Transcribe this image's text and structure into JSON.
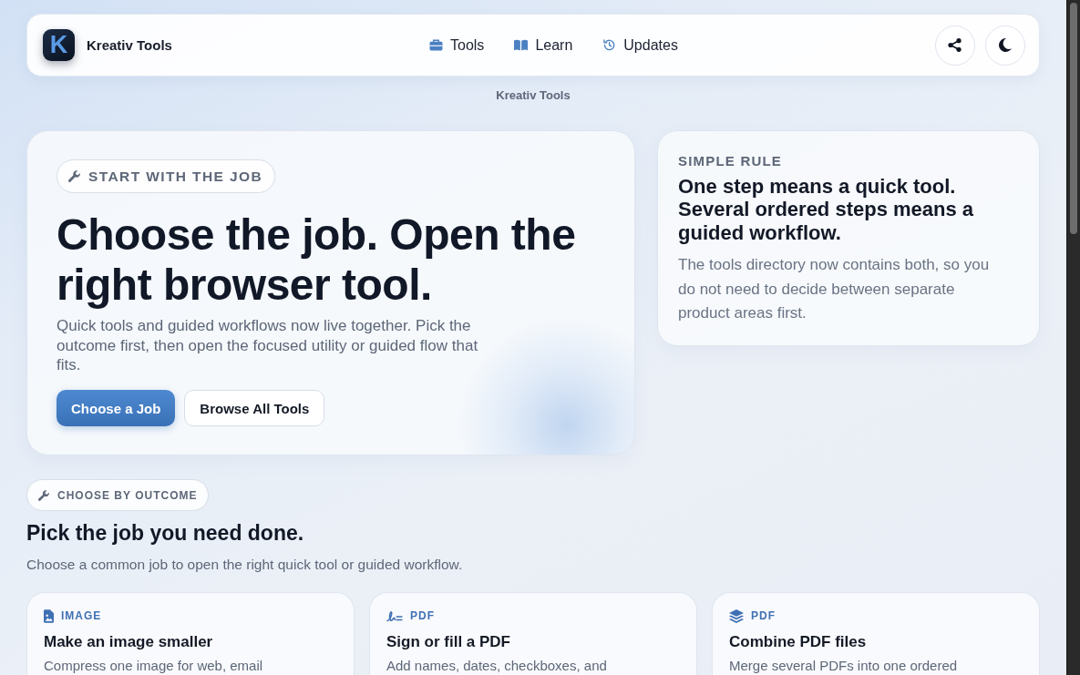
{
  "nav": {
    "brand": {
      "logo_letter": "K",
      "name": "Kreativ Tools"
    },
    "links": [
      {
        "kind": "tools",
        "label": "Tools"
      },
      {
        "kind": "learn",
        "label": "Learn"
      },
      {
        "kind": "updates",
        "label": "Updates"
      }
    ],
    "actions": [
      {
        "kind": "share"
      },
      {
        "kind": "theme"
      }
    ]
  },
  "subtitle": "Kreativ Tools",
  "hero": {
    "eyebrow": "START WITH THE JOB",
    "title": "Choose the job. Open the right browser tool.",
    "text": "Quick tools and guided workflows now live together. Pick the outcome first, then open the focused utility or guided flow that fits.",
    "buttons": [
      {
        "kind": "primary",
        "label": "Choose a Job"
      },
      {
        "kind": "secondary",
        "label": "Browse All Tools"
      }
    ]
  },
  "rule_card": {
    "eyebrow": "SIMPLE RULE",
    "title": "One step means a quick tool. Several ordered steps means a guided workflow.",
    "text": "The tools directory now contains both, so you do not need to decide between separate product areas first."
  },
  "section": {
    "eyebrow": "CHOOSE BY OUTCOME",
    "title": "Pick the job you need done.",
    "subtitle": "Choose a common job to open the right quick tool or guided workflow.",
    "cards": [
      {
        "kind": "image",
        "tag": "IMAGE",
        "title": "Make an image smaller",
        "description": "Compress one image for web, email"
      },
      {
        "kind": "sign",
        "tag": "PDF",
        "title": "Sign or fill a PDF",
        "description": "Add names, dates, checkboxes, and"
      },
      {
        "kind": "merge",
        "tag": "PDF",
        "title": "Combine PDF files",
        "description": "Merge several PDFs into one ordered"
      }
    ]
  }
}
